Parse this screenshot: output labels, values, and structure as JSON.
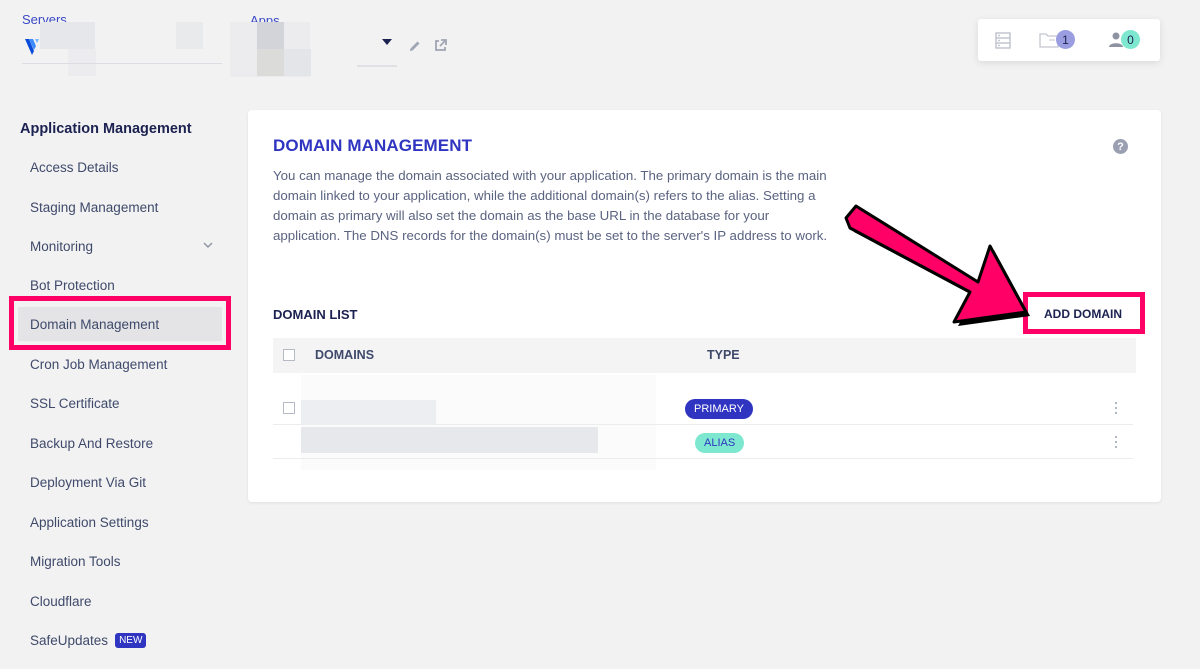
{
  "topbar": {
    "servers_label": "Servers",
    "apps_label": "Apps",
    "server_name": "",
    "app_name": "",
    "icons": {
      "logo": "vultr-logo-icon",
      "caret": "caret-down-icon",
      "edit": "pencil-icon",
      "open": "external-link-icon"
    }
  },
  "status_panel": {
    "servers_icon": "server-stack-icon",
    "apps_icon": "folder-icon",
    "apps_count": "1",
    "apps_count_color": "#9a9de0",
    "users_icon": "user-icon",
    "users_count": "0",
    "users_count_color": "#7de8cf"
  },
  "sidebar": {
    "heading": "Application Management",
    "items": [
      {
        "label": "Access Details"
      },
      {
        "label": "Staging Management"
      },
      {
        "label": "Monitoring",
        "has_submenu": true
      },
      {
        "label": "Bot Protection"
      },
      {
        "label": "Domain Management",
        "active": true
      },
      {
        "label": "Cron Job Management"
      },
      {
        "label": "SSL Certificate"
      },
      {
        "label": "Backup And Restore"
      },
      {
        "label": "Deployment Via Git"
      },
      {
        "label": "Application Settings"
      },
      {
        "label": "Migration Tools"
      },
      {
        "label": "Cloudflare"
      },
      {
        "label": "SafeUpdates",
        "badge": "NEW"
      }
    ]
  },
  "main": {
    "title": "DOMAIN MANAGEMENT",
    "description": "You can manage the domain associated with your application. The primary domain is the main domain linked to your application, while the additional domain(s) refers to the alias. Setting a domain as primary will also set the domain as the base URL in the database for your application. The DNS records for the domain(s) must be set to the server's IP address to work.",
    "help_icon": "?",
    "domain_list": {
      "title": "DOMAIN LIST",
      "add_button": "ADD DOMAIN",
      "columns": [
        "DOMAINS",
        "TYPE"
      ],
      "rows": [
        {
          "domain": "",
          "type": "PRIMARY"
        },
        {
          "domain": "",
          "type": "ALIAS"
        }
      ]
    }
  },
  "colors": {
    "accent": "#2f35c0",
    "highlight": "#ff0066",
    "alias": "#7de8cf",
    "heading": "#1b2150"
  }
}
